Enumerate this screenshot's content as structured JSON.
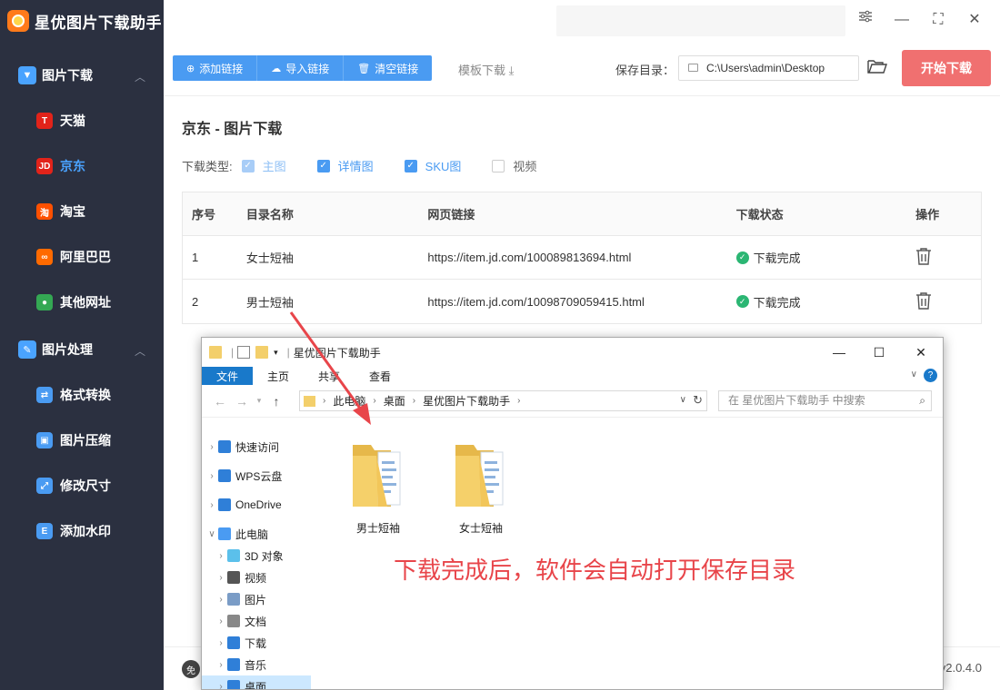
{
  "app": {
    "title": "星优图片下载助手",
    "version": "v2.0.4.0",
    "footer_badge": "免"
  },
  "sidebar": {
    "groups": [
      {
        "label": "图片下载",
        "icon": "image-download-icon",
        "items": [
          {
            "label": "天猫",
            "icon": "tmall-icon",
            "color": "#e2231a",
            "glyph": "T"
          },
          {
            "label": "京东",
            "icon": "jd-icon",
            "color": "#e2231a",
            "glyph": "JD",
            "active": true
          },
          {
            "label": "淘宝",
            "icon": "taobao-icon",
            "color": "#ff5000",
            "glyph": "淘"
          },
          {
            "label": "阿里巴巴",
            "icon": "alibaba-icon",
            "color": "#ff6a00",
            "glyph": "∞"
          },
          {
            "label": "其他网址",
            "icon": "chrome-icon",
            "color": "#34a853",
            "glyph": "●"
          }
        ]
      },
      {
        "label": "图片处理",
        "icon": "image-process-icon",
        "items": [
          {
            "label": "格式转换",
            "icon": "format-convert-icon",
            "color": "#4a9bf2",
            "glyph": "⇄"
          },
          {
            "label": "图片压缩",
            "icon": "image-compress-icon",
            "color": "#4a9bf2",
            "glyph": "▣"
          },
          {
            "label": "修改尺寸",
            "icon": "resize-icon",
            "color": "#4a9bf2",
            "glyph": "⤢"
          },
          {
            "label": "添加水印",
            "icon": "watermark-icon",
            "color": "#4a9bf2",
            "glyph": "E"
          }
        ]
      }
    ]
  },
  "toolbar": {
    "add_link": "添加链接",
    "import_link": "导入链接",
    "clear_link": "清空链接",
    "template_download": "模板下载",
    "save_dir_label": "保存目录：",
    "save_dir_value": "C:\\Users\\admin\\Desktop",
    "start_button": "开始下载",
    "accent_color": "#4a9bf2",
    "start_color": "#f07070"
  },
  "main": {
    "title": "京东 - 图片下载",
    "download_type_label": "下载类型:",
    "types": [
      {
        "label": "主图",
        "state": "checked-disabled"
      },
      {
        "label": "详情图",
        "state": "checked"
      },
      {
        "label": "SKU图",
        "state": "checked"
      },
      {
        "label": "视频",
        "state": "unchecked"
      }
    ],
    "table": {
      "headers": [
        "序号",
        "目录名称",
        "网页链接",
        "下载状态",
        "操作"
      ],
      "rows": [
        {
          "index": "1",
          "name": "女士短袖",
          "url": "https://item.jd.com/100089813694.html",
          "status": "下载完成"
        },
        {
          "index": "2",
          "name": "男士短袖",
          "url": "https://item.jd.com/10098709059415.html",
          "status": "下载完成"
        }
      ]
    }
  },
  "explorer": {
    "title": "星优图片下载助手",
    "ribbon_tabs": [
      "文件",
      "主页",
      "共享",
      "查看"
    ],
    "breadcrumb": [
      "此电脑",
      "桌面",
      "星优图片下载助手"
    ],
    "search_placeholder": "在 星优图片下载助手 中搜索",
    "tree": [
      {
        "label": "快速访问",
        "icon": "quick-access-icon",
        "level": 0,
        "color": "#2f7fd8"
      },
      {
        "label": "WPS云盘",
        "icon": "wps-cloud-icon",
        "level": 0,
        "color": "#2f7fd8"
      },
      {
        "label": "OneDrive",
        "icon": "onedrive-icon",
        "level": 0,
        "color": "#2f7fd8"
      },
      {
        "label": "此电脑",
        "icon": "this-pc-icon",
        "level": 0,
        "color": "#4a9bf2",
        "expanded": true
      },
      {
        "label": "3D 对象",
        "icon": "3d-objects-icon",
        "level": 1,
        "color": "#5bc0eb"
      },
      {
        "label": "视频",
        "icon": "videos-icon",
        "level": 1,
        "color": "#555"
      },
      {
        "label": "图片",
        "icon": "pictures-icon",
        "level": 1,
        "color": "#7a9cc6"
      },
      {
        "label": "文档",
        "icon": "documents-icon",
        "level": 1,
        "color": "#888"
      },
      {
        "label": "下载",
        "icon": "downloads-icon",
        "level": 1,
        "color": "#2f7fd8"
      },
      {
        "label": "音乐",
        "icon": "music-icon",
        "level": 1,
        "color": "#2f7fd8"
      },
      {
        "label": "桌面",
        "icon": "desktop-icon",
        "level": 1,
        "color": "#2f7fd8",
        "selected": true
      }
    ],
    "folders": [
      {
        "label": "男士短袖"
      },
      {
        "label": "女士短袖"
      }
    ]
  },
  "annotation": {
    "text": "下载完成后，软件会自动打开保存目录",
    "color": "#e8454a"
  }
}
